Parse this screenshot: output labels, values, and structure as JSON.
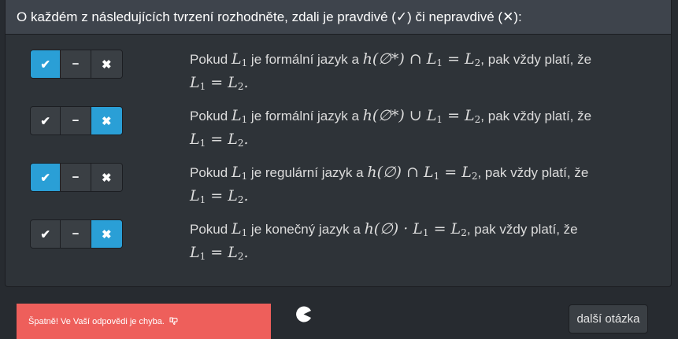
{
  "instruction": {
    "text": "O každém z následujících tvrzení rozhodněte, zdali je pravdivé (✓) či nepravdivé (✕):"
  },
  "option_labels": {
    "true": "✔",
    "unknown": "−",
    "false": "✖"
  },
  "statements": [
    {
      "selected": "true",
      "prefix": "Pokud ",
      "lang_var": "L",
      "lang_sub": "1",
      "middle": " je formální jazyk a ",
      "formula": "h(∅*) ∩ L",
      "formula_sub": "1",
      "eq": " = L",
      "eq_sub": "2",
      "suffix": ", pak vždy platí, že",
      "concl_a": "L",
      "concl_a_sub": "1",
      "concl_eq": " = L",
      "concl_b_sub": "2",
      "concl_end": "."
    },
    {
      "selected": "false",
      "prefix": "Pokud ",
      "lang_var": "L",
      "lang_sub": "1",
      "middle": " je formální jazyk a ",
      "formula": "h(∅*) ∪ L",
      "formula_sub": "1",
      "eq": " = L",
      "eq_sub": "2",
      "suffix": ", pak vždy platí, že",
      "concl_a": "L",
      "concl_a_sub": "1",
      "concl_eq": " = L",
      "concl_b_sub": "2",
      "concl_end": "."
    },
    {
      "selected": "true",
      "prefix": "Pokud ",
      "lang_var": "L",
      "lang_sub": "1",
      "middle": " je regulární jazyk a ",
      "formula": "h(∅) ∩ L",
      "formula_sub": "1",
      "eq": " = L",
      "eq_sub": "2",
      "suffix": ", pak vždy platí, že",
      "concl_a": "L",
      "concl_a_sub": "1",
      "concl_eq": " = L",
      "concl_b_sub": "2",
      "concl_end": "."
    },
    {
      "selected": "false",
      "prefix": "Pokud ",
      "lang_var": "L",
      "lang_sub": "1",
      "middle": " je konečný jazyk a ",
      "formula": "h(∅) · L",
      "formula_sub": "1",
      "eq": " = L",
      "eq_sub": "2",
      "suffix": ", pak vždy platí, že",
      "concl_a": "L",
      "concl_a_sub": "1",
      "concl_eq": " = L",
      "concl_b_sub": "2",
      "concl_end": "."
    }
  ],
  "feedback": {
    "text": "Špatně! Ve Vaší odpovědi je chyba.",
    "icon": "thumbs-down-icon"
  },
  "next_button": {
    "label": "další otázka"
  },
  "colors": {
    "selected": "#2a9fd6",
    "error": "#ee5f5b",
    "panel": "#2e3338",
    "heading": "#3e444c"
  }
}
